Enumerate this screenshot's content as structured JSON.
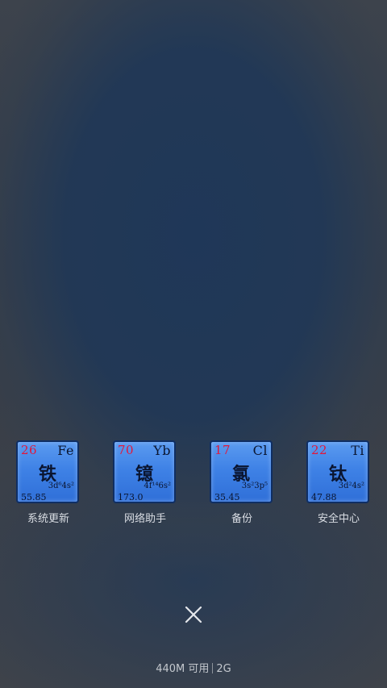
{
  "apps": [
    {
      "number": "26",
      "symbol": "Fe",
      "name_char": "铁",
      "config": "3d⁶4s²",
      "mass": "55.85",
      "label": "系统更新"
    },
    {
      "number": "70",
      "symbol": "Yb",
      "name_char": "镱",
      "config": "4f¹⁴6s²",
      "mass": "173.0",
      "label": "网络助手"
    },
    {
      "number": "17",
      "symbol": "Cl",
      "name_char": "氯",
      "config": "3s²3p⁵",
      "mass": "35.45",
      "label": "备份"
    },
    {
      "number": "22",
      "symbol": "Ti",
      "name_char": "钛",
      "config": "3d²4s²",
      "mass": "47.88",
      "label": "安全中心"
    }
  ],
  "close_icon": "close-x-icon",
  "memory": {
    "available": "440M 可用",
    "total": "2G"
  },
  "colors": {
    "tile": "#3f82e6",
    "tile_border": "#0f2e63",
    "atomic_number": "#e2173a",
    "label": "#d9dde3"
  }
}
